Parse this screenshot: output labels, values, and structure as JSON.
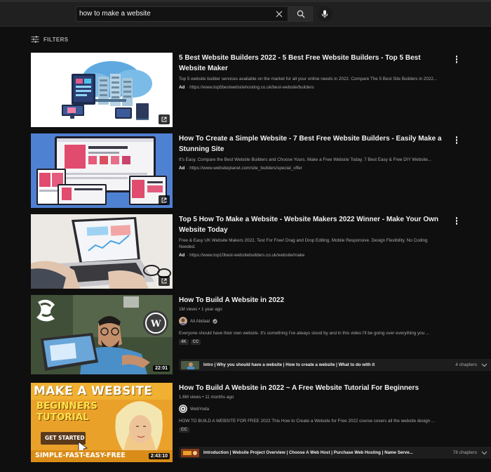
{
  "search": {
    "query": "how to make a website"
  },
  "filters": {
    "label": "FILTERS"
  },
  "ads": [
    {
      "title": "5 Best Website Builders 2022 - 5 Best Free Website Builders - Top 5 Best Website Maker",
      "description": "Top 5 website builder services available on the market for all your online needs in 2022. Compare The 5 Best Site Builders in 2022...",
      "ad_label": "Ad",
      "url": "· https://www.top5bestwebsitehosting.co.uk/best-website/builders"
    },
    {
      "title": "How To Create a Simple Website - 7 Best Free Website Builders - Easily Make a Stunning Site",
      "description": "It's Easy. Compare the Best Website Builders and Choose Yours. Make a Free Website Today. 7 Best Easy & Free DIY Website...",
      "ad_label": "Ad",
      "url": "· https://www.websiteplanet.com/site_builders/special_offer"
    },
    {
      "title": "Top 5 How To Make a Website - Website Makers 2022 Winner - Make Your Own Website Today",
      "description": "Free & Easy UK Website Makers 2022. Test For Free! Drag and Drop Editing. Mobile Responsive. Design Flexibility. No Coding Needed.",
      "ad_label": "Ad",
      "url": "· https://www.top10best-websitebuilders.co.uk/website/make"
    }
  ],
  "videos": [
    {
      "title": "How To Build A Website in 2022",
      "views": "1M views • 1 year ago",
      "channel": "Ali Abdaal",
      "description": "Everyone should have their own website. It's something I've always stood by and in this video I'll be going over everything you ...",
      "badges": [
        "4K",
        "CC"
      ],
      "duration": "22:01",
      "chapters_text": "Intro | Why you should have a website | How to create a website | What to do with it",
      "chapters_count": "4 chapters"
    },
    {
      "title": "How To Build A Website in 2022 ~ A Free Website Tutorial For Beginners",
      "views": "1.6M views • 11 months ago",
      "channel": "WebYoda",
      "description": "HOW TO BUILD A WEBSITE FOR FREE 2022 This How to Create a Website for Free 2022 course covers all the website design ...",
      "badges": [
        "CC"
      ],
      "duration": "2:43:10",
      "chapters_text": "Introduction | Website Project Overview | Choose A Web Host | Purchase Web Hosting | Name Serve...",
      "chapters_count": "78 chapters",
      "thumb_text": {
        "line1": "MAKE A WEBSITE",
        "line2": "BEGINNERS",
        "line3": "TUTORIAL",
        "button": "GET STARTED",
        "footer": "SIMPLE-FAST-EASY-FREE"
      }
    }
  ],
  "colors": {
    "background": "#0f0f0f",
    "text_primary": "#f1f1f1",
    "text_secondary": "#aaaaaa",
    "thumb_yellow": "#e9a12a"
  }
}
